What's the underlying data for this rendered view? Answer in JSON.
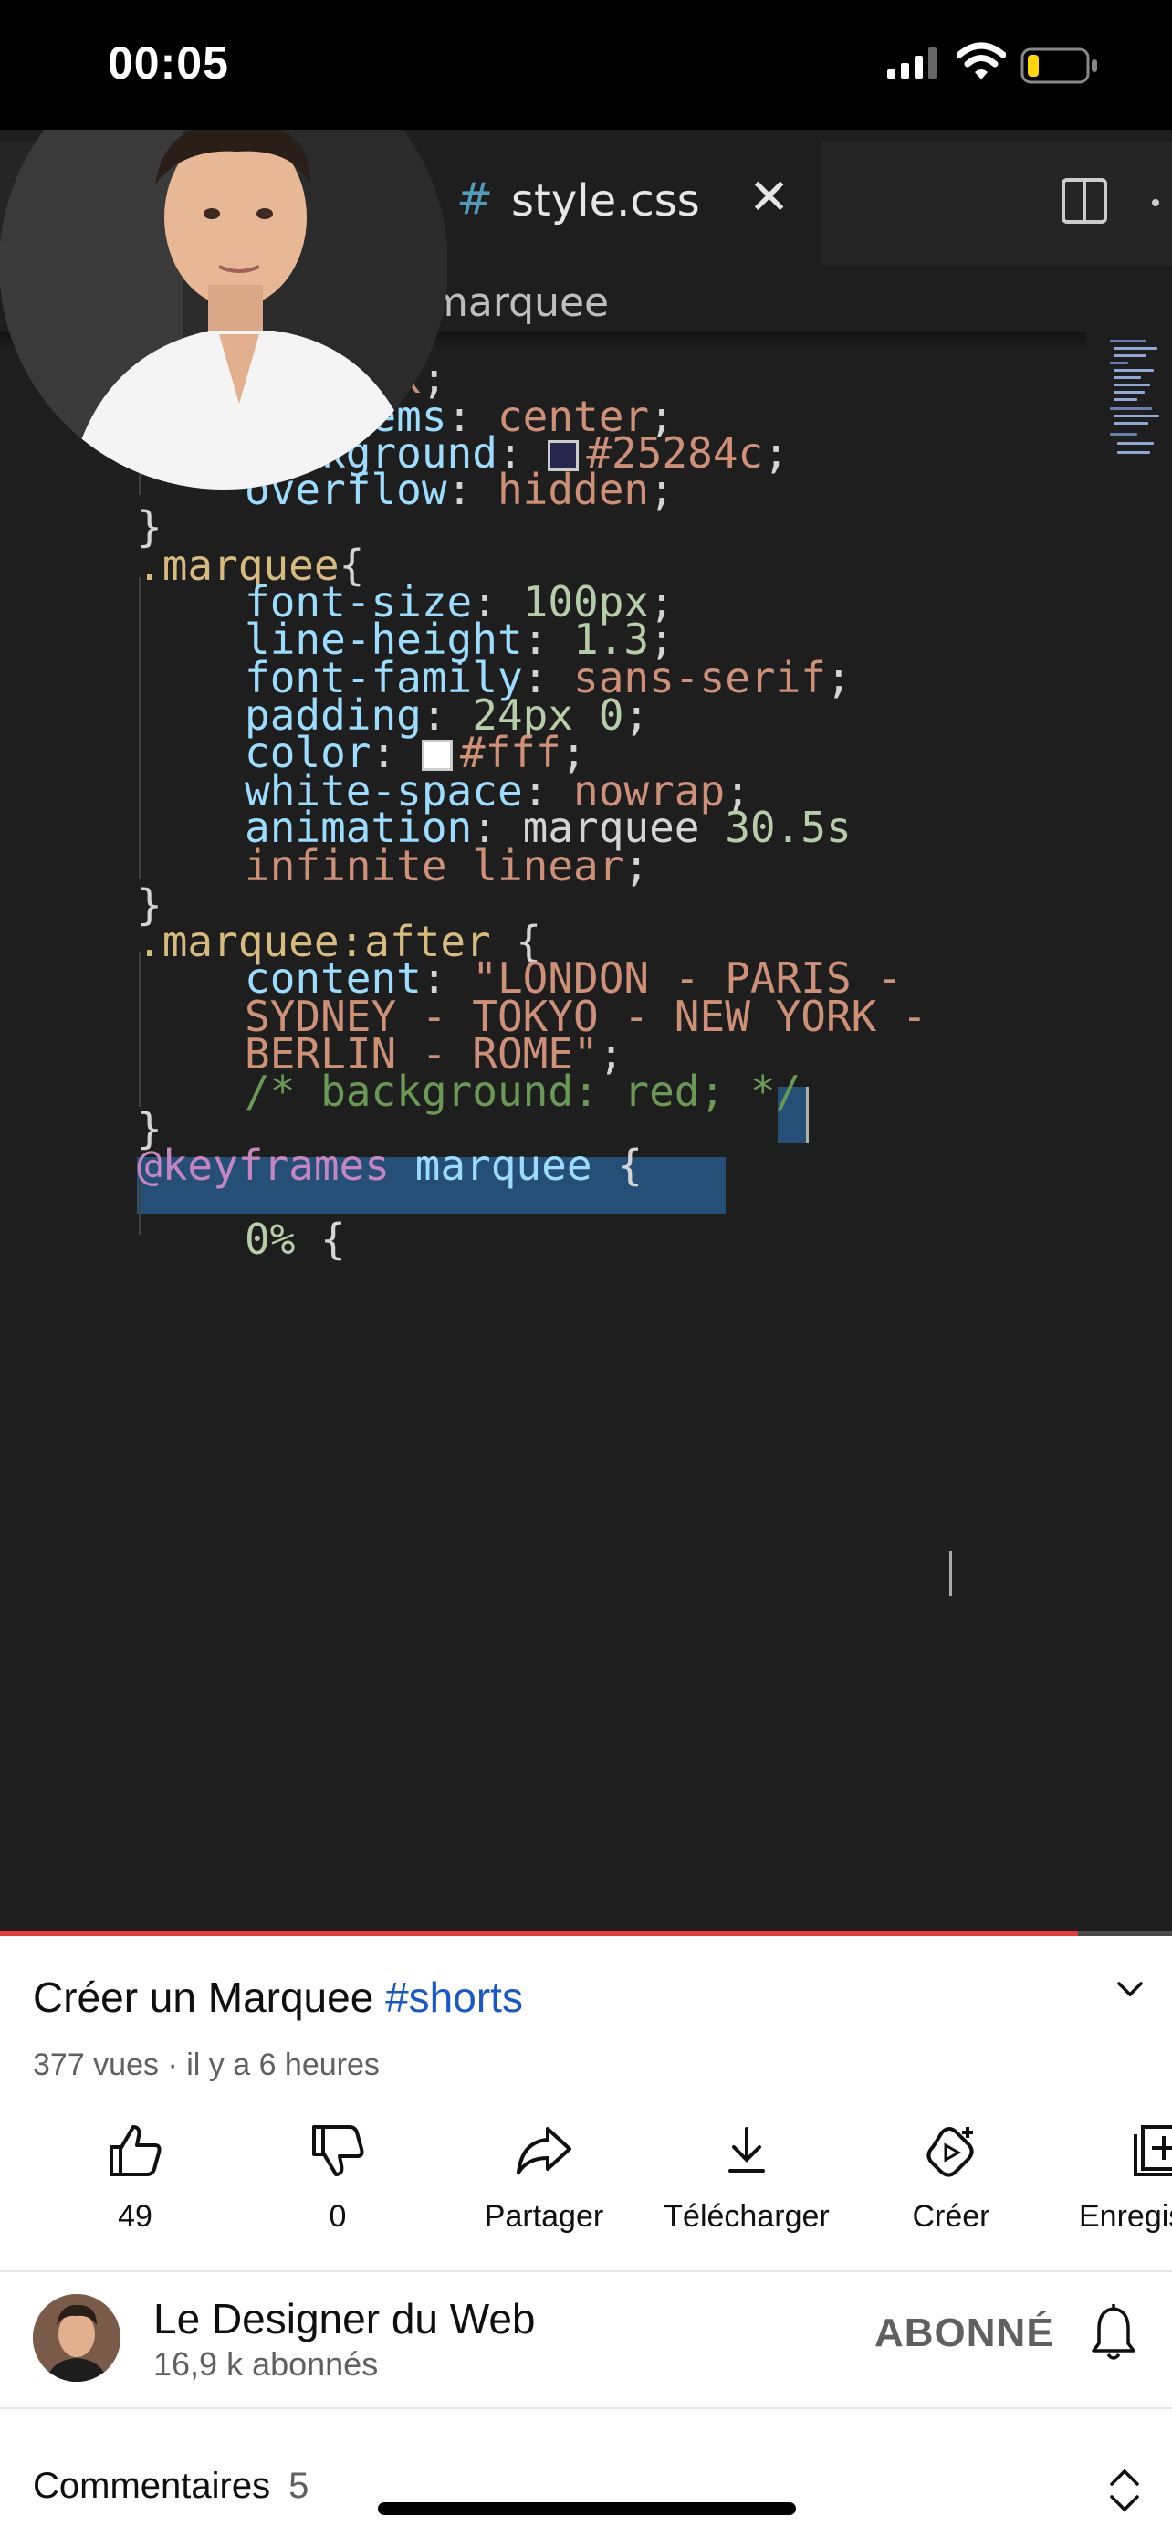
{
  "status_bar": {
    "time": "00:05",
    "battery_level": 0.2
  },
  "editor": {
    "tab_name": "style.css",
    "breadcrumb": "marquee",
    "lines": [
      {
        "tokens": [
          {
            "t": "y",
            "c": "prop"
          },
          {
            "t": ": ",
            "c": "pun"
          },
          {
            "t": "flex",
            "c": "val"
          },
          {
            "t": ";",
            "c": "pun"
          }
        ]
      },
      {
        "tokens": [
          {
            "t": "gn-items",
            "c": "prop"
          },
          {
            "t": ": ",
            "c": "pun"
          },
          {
            "t": "center",
            "c": "val"
          },
          {
            "t": ";",
            "c": "pun"
          }
        ]
      },
      {
        "tokens": [
          {
            "t": "background",
            "c": "prop"
          },
          {
            "t": ": ",
            "c": "pun"
          },
          {
            "t": "#25284c",
            "c": "val",
            "swatch": "#25284c"
          },
          {
            "t": ";",
            "c": "pun"
          }
        ]
      },
      {
        "tokens": [
          {
            "t": "overflow",
            "c": "prop"
          },
          {
            "t": ": ",
            "c": "pun"
          },
          {
            "t": "hidden",
            "c": "val"
          },
          {
            "t": ";",
            "c": "pun"
          }
        ]
      },
      {
        "tokens": [
          {
            "t": "}",
            "c": "pun"
          }
        ]
      },
      {
        "tokens": [
          {
            "t": ".marquee",
            "c": "sel"
          },
          {
            "t": "{",
            "c": "pun"
          }
        ]
      },
      {
        "tokens": [
          {
            "t": "font-size",
            "c": "prop"
          },
          {
            "t": ": ",
            "c": "pun"
          },
          {
            "t": "100px",
            "c": "num"
          },
          {
            "t": ";",
            "c": "pun"
          }
        ]
      },
      {
        "tokens": [
          {
            "t": "line-height",
            "c": "prop"
          },
          {
            "t": ": ",
            "c": "pun"
          },
          {
            "t": "1.3",
            "c": "num"
          },
          {
            "t": ";",
            "c": "pun"
          }
        ]
      },
      {
        "tokens": [
          {
            "t": "font-family",
            "c": "prop"
          },
          {
            "t": ": ",
            "c": "pun"
          },
          {
            "t": "sans-serif",
            "c": "val"
          },
          {
            "t": ";",
            "c": "pun"
          }
        ]
      },
      {
        "tokens": [
          {
            "t": "padding",
            "c": "prop"
          },
          {
            "t": ": ",
            "c": "pun"
          },
          {
            "t": "24px 0",
            "c": "num"
          },
          {
            "t": ";",
            "c": "pun"
          }
        ]
      },
      {
        "tokens": [
          {
            "t": "color",
            "c": "prop"
          },
          {
            "t": ": ",
            "c": "pun"
          },
          {
            "t": "#fff",
            "c": "val",
            "swatch": "#ffffff"
          },
          {
            "t": ";",
            "c": "pun"
          }
        ]
      },
      {
        "tokens": [
          {
            "t": "white-space",
            "c": "prop"
          },
          {
            "t": ": ",
            "c": "pun"
          },
          {
            "t": "nowrap",
            "c": "val"
          },
          {
            "t": ";",
            "c": "pun"
          }
        ]
      },
      {
        "tokens": [
          {
            "t": "animation",
            "c": "prop"
          },
          {
            "t": ": ",
            "c": "pun"
          },
          {
            "t": "marquee",
            "c": "pun"
          },
          {
            "t": " 30.5s",
            "c": "num"
          }
        ]
      },
      {
        "tokens": [
          {
            "t": "infinite linear",
            "c": "val"
          },
          {
            "t": ";",
            "c": "pun"
          }
        ]
      },
      {
        "tokens": [
          {
            "t": "}",
            "c": "pun"
          }
        ]
      },
      {
        "tokens": [
          {
            "t": ".marquee:after",
            "c": "sel"
          },
          {
            "t": " {",
            "c": "pun"
          }
        ]
      },
      {
        "tokens": [
          {
            "t": "content",
            "c": "prop"
          },
          {
            "t": ": ",
            "c": "pun"
          },
          {
            "t": "\"LONDON - PARIS -",
            "c": "str"
          }
        ]
      },
      {
        "tokens": [
          {
            "t": "SYDNEY - TOKYO - NEW YORK -",
            "c": "str"
          }
        ]
      },
      {
        "tokens": [
          {
            "t": "BERLIN - ROME\"",
            "c": "str"
          },
          {
            "t": ";",
            "c": "pun"
          }
        ]
      },
      {
        "tokens": [
          {
            "t": "/* background: red; */",
            "c": "com"
          }
        ]
      },
      {
        "tokens": [
          {
            "t": "}",
            "c": "pun"
          }
        ]
      },
      {
        "tokens": [
          {
            "t": "@keyframes",
            "c": "kw"
          },
          {
            "t": " marquee",
            "c": "prop"
          },
          {
            "t": " {",
            "c": "pun"
          }
        ]
      },
      {
        "tokens": []
      },
      {
        "tokens": [
          {
            "t": "0%",
            "c": "num"
          },
          {
            "t": " {",
            "c": "pun"
          }
        ]
      }
    ]
  },
  "player": {
    "progress": 0.92
  },
  "video": {
    "title": "Créer un Marquee",
    "hashtag": "#shorts",
    "meta": "377 vues · il y a 6 heures"
  },
  "actions": [
    {
      "label": "49",
      "icon": "thumbs-up-icon"
    },
    {
      "label": "0",
      "icon": "thumbs-down-icon"
    },
    {
      "label": "Partager",
      "icon": "share-icon"
    },
    {
      "label": "Télécharger",
      "icon": "download-icon"
    },
    {
      "label": "Créer",
      "icon": "create-icon"
    },
    {
      "label": "Enregistrer",
      "icon": "save-playlist-icon"
    }
  ],
  "channel": {
    "name": "Le Designer du Web",
    "subscribers": "16,9 k abonnés",
    "subscribed_label": "ABONNÉ"
  },
  "comments": {
    "label": "Commentaires",
    "count": "5"
  },
  "colors": {
    "progress": "#e53935",
    "hashtag": "#1a57c9",
    "editor_bg": "#1e1e1e"
  }
}
